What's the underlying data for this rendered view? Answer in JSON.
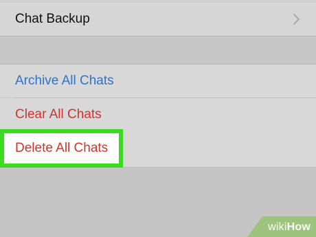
{
  "settings": {
    "backup_row": {
      "label": "Chat Backup",
      "chevron_icon": "chevron-right-icon"
    },
    "actions": {
      "archive_label": "Archive All Chats",
      "clear_label": "Clear All Chats",
      "delete_label": "Delete All Chats"
    }
  },
  "watermark": {
    "wiki": "wiki",
    "how": "How"
  },
  "colors": {
    "archive": "#2f73c9",
    "destructive": "#d0342c",
    "highlight": "#3bdc1f",
    "background": "#c8c8c8"
  }
}
